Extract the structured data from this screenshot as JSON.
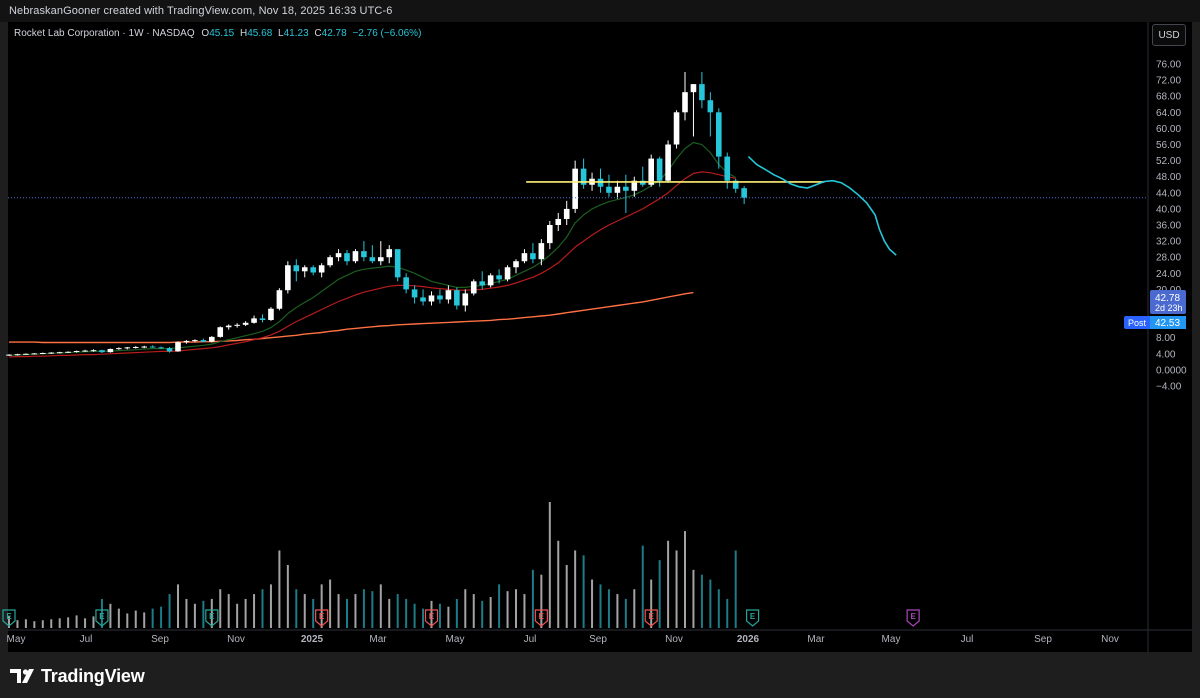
{
  "header": {
    "text": "NebraskanGooner created with TradingView.com, Nov 18, 2025 16:33 UTC-6"
  },
  "legend": {
    "symbol": "Rocket Lab Corporation · 1W · NASDAQ",
    "open_label": "O",
    "open": "45.15",
    "high_label": "H",
    "high": "45.68",
    "low_label": "L",
    "low": "41.23",
    "close_label": "C",
    "close": "42.78",
    "change": "−2.76 (−6.06%)"
  },
  "currency_button": "USD",
  "price_tags": {
    "last": "42.78",
    "countdown": "2d 23h",
    "post_label": "Post",
    "post": "42.53"
  },
  "footer": {
    "logo_text": "TradingView"
  },
  "colors": {
    "up": "#ffffff",
    "down": "#26c6da",
    "ema_fast": "#1b5e20",
    "ema_mid": "#b71c1c",
    "ema_slow": "#ff7043",
    "hline": "#fff176",
    "projection": "#26c6da",
    "last_price": "#4a6ad0",
    "earnings": "#ef5350",
    "earnings_next": "#ab47bc",
    "earnings_teal": "#26a69a"
  },
  "chart_data": {
    "type": "candlestick",
    "title": "Rocket Lab Corporation · 1W · NASDAQ",
    "y_ticks": [
      "76.00",
      "72.00",
      "68.00",
      "64.00",
      "60.00",
      "56.00",
      "52.00",
      "48.00",
      "44.00",
      "40.00",
      "36.00",
      "32.00",
      "28.00",
      "24.00",
      "20.00",
      "16.00",
      "12.00",
      "8.00",
      "4.00",
      "0.0000",
      "−4.00"
    ],
    "ylim": [
      -4,
      76
    ],
    "x_ticks": [
      "May",
      "Jul",
      "Sep",
      "Nov",
      "2025",
      "Mar",
      "May",
      "Jul",
      "Sep",
      "Nov",
      "2026",
      "Mar",
      "May",
      "Jul",
      "Sep",
      "Nov"
    ],
    "candles_ohlc": [
      [
        3.6,
        3.9,
        3.5,
        3.8
      ],
      [
        3.8,
        4.0,
        3.6,
        3.9
      ],
      [
        3.9,
        4.1,
        3.8,
        4.0
      ],
      [
        4.0,
        4.2,
        3.9,
        4.1
      ],
      [
        4.1,
        4.3,
        3.9,
        4.2
      ],
      [
        4.2,
        4.4,
        4.0,
        4.3
      ],
      [
        4.3,
        4.5,
        4.1,
        4.4
      ],
      [
        4.4,
        4.6,
        4.2,
        4.5
      ],
      [
        4.5,
        4.8,
        4.3,
        4.7
      ],
      [
        4.7,
        5.0,
        4.5,
        4.8
      ],
      [
        4.8,
        5.1,
        4.5,
        4.9
      ],
      [
        4.9,
        5.0,
        4.2,
        4.4
      ],
      [
        4.4,
        5.3,
        4.3,
        5.2
      ],
      [
        5.2,
        5.6,
        5.0,
        5.4
      ],
      [
        5.4,
        5.7,
        5.1,
        5.6
      ],
      [
        5.6,
        5.9,
        5.3,
        5.7
      ],
      [
        5.7,
        6.0,
        5.4,
        5.8
      ],
      [
        5.8,
        6.1,
        5.5,
        5.6
      ],
      [
        5.6,
        5.8,
        5.2,
        5.4
      ],
      [
        5.4,
        5.7,
        4.3,
        4.6
      ],
      [
        4.6,
        7.1,
        4.5,
        6.9
      ],
      [
        6.9,
        7.4,
        6.5,
        7.2
      ],
      [
        7.2,
        7.6,
        6.9,
        7.4
      ],
      [
        7.4,
        7.8,
        6.9,
        7.0
      ],
      [
        7.0,
        8.4,
        6.8,
        8.2
      ],
      [
        8.2,
        10.8,
        8.0,
        10.6
      ],
      [
        10.6,
        11.3,
        10.0,
        11.0
      ],
      [
        11.0,
        11.6,
        10.5,
        11.2
      ],
      [
        11.2,
        12.1,
        10.9,
        11.7
      ],
      [
        11.7,
        13.5,
        11.5,
        12.8
      ],
      [
        12.8,
        13.8,
        11.8,
        12.4
      ],
      [
        12.4,
        15.6,
        12.2,
        15.2
      ],
      [
        15.2,
        20.3,
        14.8,
        19.8
      ],
      [
        19.8,
        27.0,
        19.0,
        26.0
      ],
      [
        26.0,
        27.5,
        22.0,
        24.5
      ],
      [
        24.5,
        26.0,
        23.0,
        25.5
      ],
      [
        25.5,
        26.0,
        23.5,
        24.2
      ],
      [
        24.2,
        26.5,
        23.0,
        26.0
      ],
      [
        26.0,
        28.5,
        25.5,
        28.0
      ],
      [
        28.0,
        30.0,
        27.0,
        29.0
      ],
      [
        29.0,
        29.8,
        26.0,
        27.0
      ],
      [
        27.0,
        30.0,
        26.5,
        29.5
      ],
      [
        29.5,
        32.0,
        27.0,
        28.0
      ],
      [
        28.0,
        31.0,
        26.5,
        27.0
      ],
      [
        27.0,
        32.0,
        26.0,
        28.0
      ],
      [
        28.0,
        31.0,
        26.5,
        30.0
      ],
      [
        30.0,
        28.5,
        22.0,
        23.0
      ],
      [
        23.0,
        24.0,
        19.0,
        20.0
      ],
      [
        20.0,
        21.0,
        16.5,
        18.0
      ],
      [
        18.0,
        20.0,
        16.0,
        17.0
      ],
      [
        17.0,
        19.5,
        16.0,
        18.5
      ],
      [
        18.5,
        20.0,
        16.5,
        17.5
      ],
      [
        17.5,
        21.0,
        16.5,
        19.8
      ],
      [
        19.8,
        20.5,
        15.0,
        16.0
      ],
      [
        16.0,
        20.0,
        14.5,
        19.0
      ],
      [
        19.0,
        22.5,
        18.5,
        22.0
      ],
      [
        22.0,
        24.5,
        20.0,
        21.0
      ],
      [
        21.0,
        24.0,
        20.5,
        23.5
      ],
      [
        23.5,
        25.0,
        21.5,
        22.5
      ],
      [
        22.5,
        26.0,
        22.0,
        25.5
      ],
      [
        25.5,
        27.5,
        24.0,
        27.0
      ],
      [
        27.0,
        30.0,
        26.5,
        29.0
      ],
      [
        29.0,
        31.5,
        26.5,
        27.5
      ],
      [
        27.5,
        32.5,
        26.0,
        31.5
      ],
      [
        31.5,
        37.0,
        30.0,
        36.0
      ],
      [
        36.0,
        39.0,
        34.5,
        37.5
      ],
      [
        37.5,
        42.0,
        36.0,
        40.0
      ],
      [
        40.0,
        52.0,
        39.0,
        50.0
      ],
      [
        50.0,
        52.5,
        45.0,
        46.0
      ],
      [
        46.0,
        49.0,
        44.5,
        47.5
      ],
      [
        47.5,
        50.0,
        44.0,
        45.5
      ],
      [
        45.5,
        48.5,
        43.0,
        44.0
      ],
      [
        44.0,
        47.0,
        42.5,
        45.5
      ],
      [
        45.5,
        48.5,
        39.0,
        44.5
      ],
      [
        44.5,
        48.0,
        43.0,
        47.0
      ],
      [
        47.0,
        50.5,
        45.5,
        46.0
      ],
      [
        46.0,
        53.5,
        45.5,
        52.5
      ],
      [
        52.5,
        53.0,
        45.5,
        47.0
      ],
      [
        47.0,
        57.0,
        46.5,
        56.0
      ],
      [
        56.0,
        64.5,
        55.0,
        64.0
      ],
      [
        64.0,
        74.0,
        62.0,
        69.0
      ],
      [
        69.0,
        71.0,
        58.0,
        71.0
      ],
      [
        71.0,
        74.0,
        65.0,
        67.0
      ],
      [
        67.0,
        69.0,
        58.0,
        64.0
      ],
      [
        64.0,
        65.0,
        50.0,
        53.0
      ],
      [
        53.0,
        54.0,
        45.0,
        47.0
      ],
      [
        47.0,
        47.5,
        44.0,
        45.0
      ],
      [
        45.15,
        45.68,
        41.23,
        42.78
      ]
    ],
    "volume_scale_max": 13.0,
    "volume": [
      1.2,
      0.8,
      0.9,
      0.7,
      0.8,
      0.9,
      1.0,
      1.1,
      1.3,
      1.0,
      1.2,
      3.0,
      2.5,
      2.0,
      1.5,
      1.8,
      1.6,
      2.0,
      2.2,
      3.5,
      4.5,
      3.0,
      2.5,
      2.8,
      3.0,
      4.0,
      3.5,
      2.5,
      3.0,
      3.5,
      4.0,
      4.5,
      8.0,
      6.5,
      4.0,
      3.5,
      3.0,
      4.5,
      5.0,
      3.5,
      3.0,
      3.5,
      4.0,
      3.8,
      4.5,
      3.0,
      3.5,
      3.0,
      2.5,
      2.0,
      2.8,
      2.5,
      2.2,
      3.0,
      4.0,
      3.5,
      2.8,
      3.2,
      4.5,
      3.8,
      4.0,
      3.5,
      6.0,
      5.5,
      13.0,
      9.0,
      6.5,
      8.0,
      7.5,
      5.0,
      4.5,
      4.0,
      3.5,
      3.0,
      4.0,
      8.5,
      5.0,
      7.0,
      9.0,
      8.0,
      10.0,
      6.0,
      5.5,
      5.0,
      4.0,
      3.0,
      8.0
    ],
    "ema_fast": [
      3.6,
      3.7,
      3.8,
      3.9,
      4.0,
      4.1,
      4.2,
      4.3,
      4.4,
      4.5,
      4.6,
      4.6,
      4.7,
      4.8,
      4.9,
      5.0,
      5.2,
      5.3,
      5.3,
      5.3,
      5.5,
      5.7,
      5.9,
      6.1,
      6.4,
      7.0,
      7.5,
      8.0,
      8.5,
      9.0,
      9.6,
      10.5,
      12.0,
      14.0,
      15.5,
      16.8,
      18.0,
      19.5,
      21.0,
      22.5,
      23.5,
      24.5,
      25.0,
      25.3,
      25.5,
      25.8,
      25.5,
      24.8,
      24.0,
      23.0,
      22.0,
      21.5,
      21.0,
      20.5,
      20.5,
      20.8,
      21.0,
      21.5,
      22.0,
      22.5,
      23.5,
      24.5,
      25.5,
      26.8,
      28.5,
      30.5,
      33.0,
      36.5,
      38.5,
      40.0,
      41.0,
      41.8,
      42.3,
      42.8,
      43.5,
      44.5,
      45.8,
      47.0,
      49.5,
      52.5,
      55.0,
      56.5,
      56.0,
      54.0,
      51.0,
      49.0,
      47.8
    ],
    "ema_mid": [
      3.2,
      3.3,
      3.3,
      3.4,
      3.4,
      3.5,
      3.6,
      3.6,
      3.7,
      3.8,
      3.8,
      3.9,
      4.0,
      4.1,
      4.2,
      4.3,
      4.4,
      4.5,
      4.6,
      4.6,
      4.7,
      4.9,
      5.1,
      5.3,
      5.5,
      5.8,
      6.2,
      6.6,
      7.0,
      7.5,
      8.0,
      8.7,
      9.6,
      10.8,
      12.0,
      13.0,
      14.0,
      15.0,
      16.0,
      17.0,
      17.8,
      18.6,
      19.3,
      19.8,
      20.3,
      20.8,
      21.0,
      21.0,
      20.9,
      20.7,
      20.4,
      20.2,
      20.0,
      19.8,
      19.8,
      19.9,
      20.0,
      20.3,
      20.6,
      21.0,
      21.6,
      22.3,
      23.0,
      24.0,
      25.2,
      26.6,
      28.5,
      30.5,
      32.0,
      33.5,
      34.8,
      36.0,
      37.0,
      38.0,
      39.0,
      40.0,
      41.3,
      42.5,
      44.0,
      45.8,
      47.5,
      48.8,
      49.2,
      49.0,
      48.5,
      48.0,
      47.6
    ],
    "ema_slow": [
      6.9,
      6.9,
      6.9,
      6.9,
      6.8,
      6.8,
      6.8,
      6.8,
      6.8,
      6.8,
      6.8,
      6.8,
      6.8,
      6.8,
      6.8,
      6.8,
      6.8,
      6.8,
      6.8,
      6.8,
      6.9,
      6.9,
      6.9,
      7.0,
      7.0,
      7.1,
      7.2,
      7.3,
      7.5,
      7.6,
      7.8,
      8.0,
      8.2,
      8.4,
      8.6,
      8.9,
      9.1,
      9.3,
      9.6,
      9.8,
      10.1,
      10.3,
      10.5,
      10.7,
      10.9,
      11.0,
      11.2,
      11.3,
      11.4,
      11.5,
      11.6,
      11.7,
      11.8,
      11.9,
      12.0,
      12.1,
      12.2,
      12.3,
      12.5,
      12.6,
      12.8,
      13.0,
      13.2,
      13.4,
      13.6,
      13.9,
      14.2,
      14.5,
      14.8,
      15.1,
      15.4,
      15.7,
      16.0,
      16.3,
      16.6,
      16.9,
      17.3,
      17.7,
      18.1,
      18.5,
      18.9,
      19.2
    ],
    "horizontal_level": 46.7,
    "earnings_markers": [
      {
        "x_index": 0,
        "kind": "teal"
      },
      {
        "x_index": 11,
        "kind": "teal"
      },
      {
        "x_index": 24,
        "kind": "teal"
      },
      {
        "x_index": 37,
        "kind": "red"
      },
      {
        "x_index": 50,
        "kind": "red"
      },
      {
        "x_index": 63,
        "kind": "red"
      },
      {
        "x_index": 76,
        "kind": "red"
      },
      {
        "x_index": 88,
        "kind": "teal"
      },
      {
        "x_index": 107,
        "kind": "purple"
      }
    ],
    "projection_path": [
      [
        87.5,
        53.0
      ],
      [
        88.5,
        51.0
      ],
      [
        89.5,
        49.8
      ],
      [
        90.5,
        48.5
      ],
      [
        91.5,
        47.5
      ],
      [
        92.5,
        46.2
      ],
      [
        93.5,
        45.5
      ],
      [
        94.5,
        45.2
      ],
      [
        95.5,
        46.0
      ],
      [
        96.5,
        46.8
      ],
      [
        97.5,
        47.0
      ],
      [
        98.5,
        46.5
      ],
      [
        99.5,
        45.2
      ],
      [
        100.5,
        43.5
      ],
      [
        101.5,
        41.5
      ],
      [
        102.5,
        38.5
      ],
      [
        103.0,
        35.0
      ],
      [
        103.6,
        32.0
      ],
      [
        104.2,
        30.0
      ],
      [
        105.0,
        28.5
      ]
    ]
  }
}
